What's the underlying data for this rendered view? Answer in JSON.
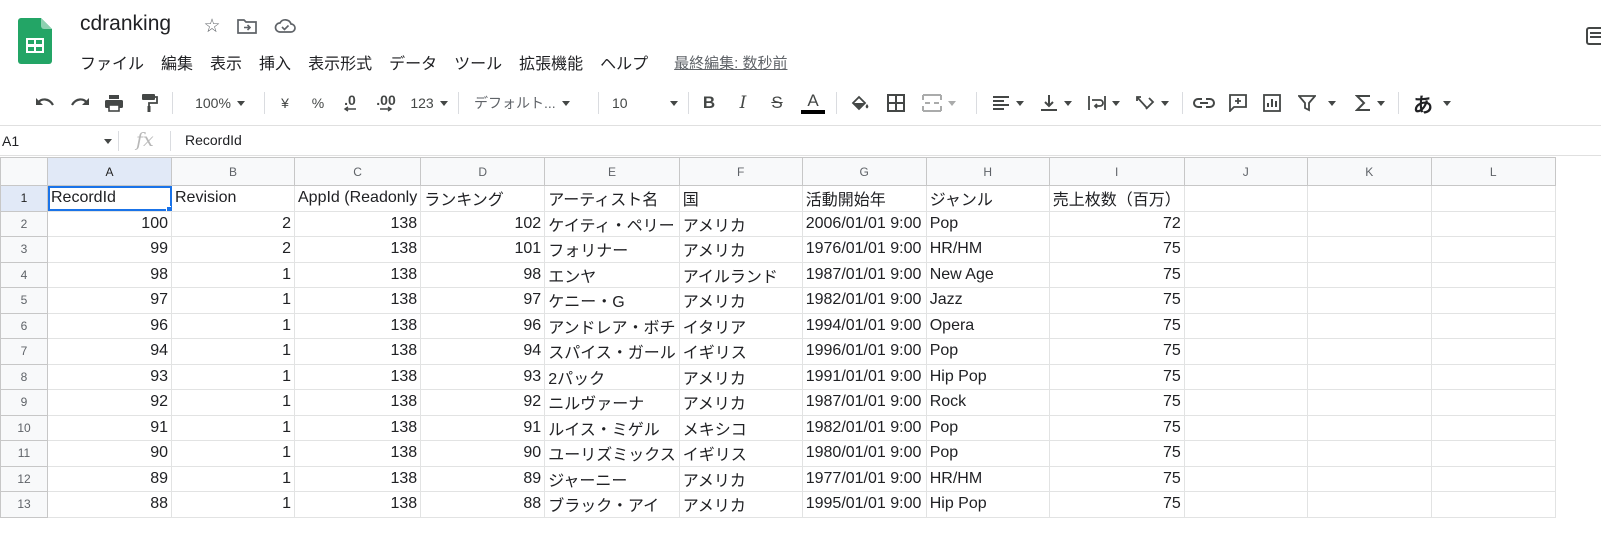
{
  "app": {
    "doc_title": "cdranking",
    "last_edit": "最終編集: 数秒前",
    "menu": [
      "ファイル",
      "編集",
      "表示",
      "挿入",
      "表示形式",
      "データ",
      "ツール",
      "拡張機能",
      "ヘルプ"
    ]
  },
  "toolbar": {
    "zoom": "100%",
    "currency": "¥",
    "percent": "%",
    "decimal_decrease": ".0",
    "decimal_increase": ".00",
    "number_format": "123",
    "font_family": "デフォルト...",
    "font_size": "10",
    "bold": "B",
    "italic": "I",
    "strike": "S",
    "text_color": "A",
    "input_tool": "あ"
  },
  "formula_bar": {
    "cell_ref": "A1",
    "fx": "fx",
    "value": "RecordId"
  },
  "sheet": {
    "columns": [
      "A",
      "B",
      "C",
      "D",
      "E",
      "F",
      "G",
      "H",
      "I",
      "J",
      "K",
      "L"
    ],
    "header_row": {
      "row": "1",
      "cells": [
        "RecordId",
        "Revision",
        "AppId (Readonly",
        "ランキング",
        "アーティスト名",
        "国",
        "活動開始年",
        "ジャンル",
        "売上枚数（百万）",
        "",
        "",
        ""
      ]
    },
    "rows": [
      {
        "row": "2",
        "cells": [
          "100",
          "2",
          "138",
          "102",
          "ケイティ・ペリー",
          "アメリカ",
          "2006/01/01 9:00",
          "Pop",
          "72",
          "",
          "",
          ""
        ]
      },
      {
        "row": "3",
        "cells": [
          "99",
          "2",
          "138",
          "101",
          "フォリナー",
          "アメリカ",
          "1976/01/01 9:00",
          "HR/HM",
          "75",
          "",
          "",
          ""
        ]
      },
      {
        "row": "4",
        "cells": [
          "98",
          "1",
          "138",
          "98",
          "エンヤ",
          "アイルランド",
          "1987/01/01 9:00",
          "New Age",
          "75",
          "",
          "",
          ""
        ]
      },
      {
        "row": "5",
        "cells": [
          "97",
          "1",
          "138",
          "97",
          "ケニー・G",
          "アメリカ",
          "1982/01/01 9:00",
          "Jazz",
          "75",
          "",
          "",
          ""
        ]
      },
      {
        "row": "6",
        "cells": [
          "96",
          "1",
          "138",
          "96",
          "アンドレア・ボチ",
          "イタリア",
          "1994/01/01 9:00",
          "Opera",
          "75",
          "",
          "",
          ""
        ]
      },
      {
        "row": "7",
        "cells": [
          "94",
          "1",
          "138",
          "94",
          "スパイス・ガール",
          "イギリス",
          "1996/01/01 9:00",
          "Pop",
          "75",
          "",
          "",
          ""
        ]
      },
      {
        "row": "8",
        "cells": [
          "93",
          "1",
          "138",
          "93",
          "2パック",
          "アメリカ",
          "1991/01/01 9:00",
          "Hip Pop",
          "75",
          "",
          "",
          ""
        ]
      },
      {
        "row": "9",
        "cells": [
          "92",
          "1",
          "138",
          "92",
          "ニルヴァーナ",
          "アメリカ",
          "1987/01/01 9:00",
          "Rock",
          "75",
          "",
          "",
          ""
        ]
      },
      {
        "row": "10",
        "cells": [
          "91",
          "1",
          "138",
          "91",
          "ルイス・ミゲル",
          "メキシコ",
          "1982/01/01 9:00",
          "Pop",
          "75",
          "",
          "",
          ""
        ]
      },
      {
        "row": "11",
        "cells": [
          "90",
          "1",
          "138",
          "90",
          "ユーリズミックス",
          "イギリス",
          "1980/01/01 9:00",
          "Pop",
          "75",
          "",
          "",
          ""
        ]
      },
      {
        "row": "12",
        "cells": [
          "89",
          "1",
          "138",
          "89",
          "ジャーニー",
          "アメリカ",
          "1977/01/01 9:00",
          "HR/HM",
          "75",
          "",
          "",
          ""
        ]
      },
      {
        "row": "13",
        "cells": [
          "88",
          "1",
          "138",
          "88",
          "ブラック・アイ",
          "アメリカ",
          "1995/01/01 9:00",
          "Hip Pop",
          "75",
          "",
          "",
          ""
        ]
      }
    ],
    "numeric_columns": [
      0,
      1,
      2,
      3,
      8
    ],
    "selected_cell": "A1"
  },
  "colors": {
    "logo_green": "#23a566",
    "selection_blue": "#1a73e8",
    "header_bg": "#f8f9fa"
  }
}
